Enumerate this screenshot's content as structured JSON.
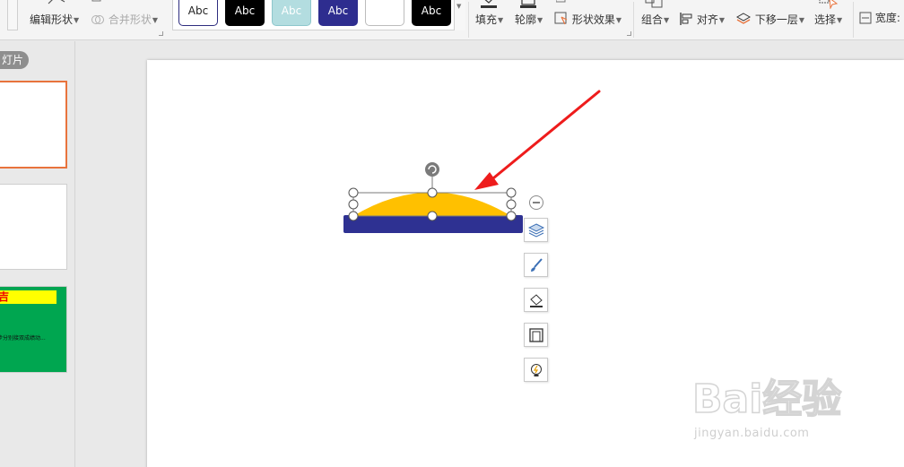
{
  "ribbon": {
    "edit_shape": "编辑形状",
    "merge_shapes": "合并形状",
    "style_gallery": [
      {
        "label": "Abc",
        "bg": "#ffffff",
        "fg": "#222222",
        "border": "#2e2d7f"
      },
      {
        "label": "Abc",
        "bg": "#000000",
        "fg": "#ffffff",
        "border": "#000000"
      },
      {
        "label": "Abc",
        "bg": "#b3dde0",
        "fg": "#ffffff",
        "border": "#8ec7cc"
      },
      {
        "label": "Abc",
        "bg": "#2e2d8f",
        "fg": "#ffffff",
        "border": "#2e2d8f"
      },
      {
        "label": "",
        "bg": "#ffffff",
        "fg": "#222222",
        "border": "#bcbcbc"
      },
      {
        "label": "Abc",
        "bg": "#000000",
        "fg": "#ffffff",
        "border": "#000000"
      }
    ],
    "fill": "填充",
    "outline": "轮廓",
    "shape_effects": "形状效果",
    "group": "组合",
    "align": "对齐",
    "send_backward": "下移一层",
    "select": "选择",
    "width_label": "宽度:"
  },
  "thumbnails": {
    "pane_tab": "灯片",
    "slide3_title": "吉",
    "slide3_text": "步分别接双成绩动..."
  },
  "colors": {
    "dome": "#ffc000",
    "bar": "#2e3192",
    "arrow": "#ee1c1c",
    "selected_thumb_border": "#e8733c",
    "thumb3_bg": "#00a650"
  },
  "float_tools": [
    "layers-icon",
    "brush-icon",
    "fill-bucket-icon",
    "outline-icon",
    "lightbulb-icon"
  ],
  "watermark": {
    "text": "Bai经验",
    "url": "jingyan.baidu.com"
  }
}
